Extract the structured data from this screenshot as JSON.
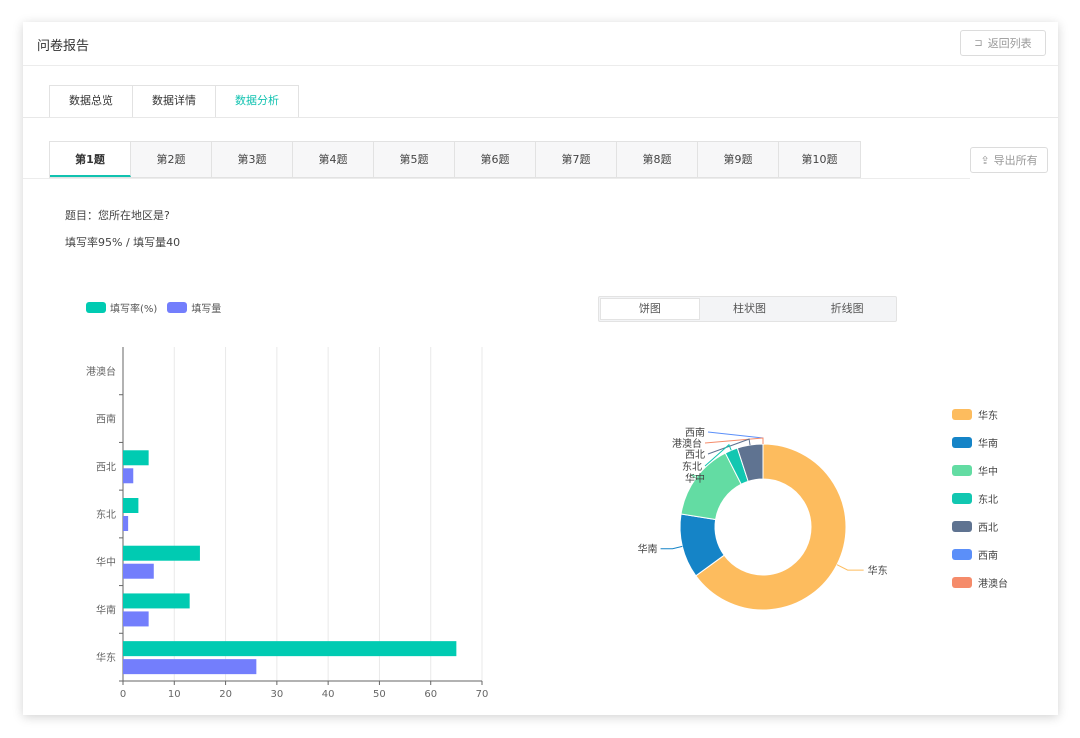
{
  "header": {
    "title": "问卷报告",
    "back_label": "返回列表"
  },
  "main_tabs": [
    {
      "label": "数据总览"
    },
    {
      "label": "数据详情"
    },
    {
      "label": "数据分析",
      "active": true
    }
  ],
  "question_tabs": [
    {
      "label": "第1题",
      "active": true
    },
    {
      "label": "第2题"
    },
    {
      "label": "第3题"
    },
    {
      "label": "第4题"
    },
    {
      "label": "第5题"
    },
    {
      "label": "第6题"
    },
    {
      "label": "第7题"
    },
    {
      "label": "第8题"
    },
    {
      "label": "第9题"
    },
    {
      "label": "第10题"
    }
  ],
  "export_label": "导出所有",
  "question": {
    "text": "题目：您所在地区是?",
    "rate_text": "填写率95% / 填写量40"
  },
  "chart_switch": [
    {
      "label": "饼图",
      "active": true
    },
    {
      "label": "柱状图"
    },
    {
      "label": "折线图"
    }
  ],
  "colors": {
    "accent": "#11c2b0",
    "rate": "#00cbb2",
    "count": "#737efc"
  },
  "chart_data": [
    {
      "type": "bar",
      "orientation": "horizontal",
      "categories": [
        "华东",
        "华南",
        "华中",
        "东北",
        "西北",
        "西南",
        "港澳台"
      ],
      "series": [
        {
          "name": "填写率(%)",
          "color": "#00cbb2",
          "values": [
            65,
            13,
            15,
            3,
            5,
            0,
            0
          ]
        },
        {
          "name": "填写量",
          "color": "#737efc",
          "values": [
            26,
            5,
            6,
            1,
            2,
            0,
            0
          ]
        }
      ],
      "xlim": [
        0,
        70
      ],
      "xticks": [
        0,
        10,
        20,
        30,
        40,
        50,
        60,
        70
      ],
      "grid": true,
      "legend_position": "top-left"
    },
    {
      "type": "pie",
      "variant": "donut",
      "slices": [
        {
          "label": "华东",
          "value": 26,
          "color": "#fdbc5e"
        },
        {
          "label": "华南",
          "value": 5,
          "color": "#1584c7"
        },
        {
          "label": "华中",
          "value": 6,
          "color": "#63dca3"
        },
        {
          "label": "东北",
          "value": 1,
          "color": "#12c7b1"
        },
        {
          "label": "西北",
          "value": 2,
          "color": "#5f7391"
        },
        {
          "label": "西南",
          "value": 0,
          "color": "#5b8ff9"
        },
        {
          "label": "港澳台",
          "value": 0,
          "color": "#f58b6a"
        }
      ],
      "legend_position": "right"
    }
  ]
}
